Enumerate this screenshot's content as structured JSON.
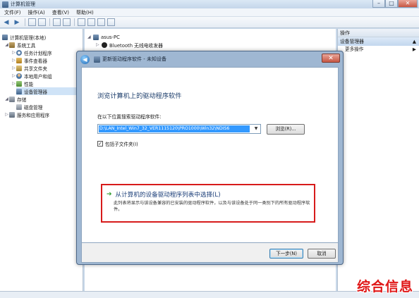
{
  "window": {
    "title": "计算机管理"
  },
  "menu": [
    "文件(F)",
    "操作(A)",
    "查看(V)",
    "帮助(H)"
  ],
  "tree": {
    "root": "计算机管理(本地)",
    "system_tools": "系统工具",
    "task_scheduler": "任务计划程序",
    "event_viewer": "事件查看器",
    "shared_folders": "共享文件夹",
    "local_users": "本地用户和组",
    "performance": "性能",
    "device_manager": "设备管理器",
    "storage": "存储",
    "disk_management": "磁盘管理",
    "services_apps": "服务和应用程序"
  },
  "devices": {
    "computer": "asus-PC",
    "bluetooth": "Bluetooth 无线电收发器"
  },
  "actions": {
    "header": "操作",
    "section": "设备管理器",
    "more": "更多操作"
  },
  "dialog": {
    "title": "更新驱动程序软件 - 未知设备",
    "heading": "浏览计算机上的驱动程序软件",
    "search_label": "在以下位置搜索驱动程序软件:",
    "path_value": "D:\\LAN_Intel_Win7_32_VER1115120\\PRO1000\\Win32\\NDIS6",
    "browse_label": "浏览(R)...",
    "include_subfolders": "包括子文件夹(I)",
    "option_title": "从计算机的设备驱动程序列表中选择(L)",
    "option_desc": "此列表将显示与该设备兼容的已安装的驱动程序软件，以及与该设备处于同一类别下的所有驱动程序软件。",
    "next_label": "下一步(N)",
    "cancel_label": "取消"
  },
  "watermark": "综合信息"
}
